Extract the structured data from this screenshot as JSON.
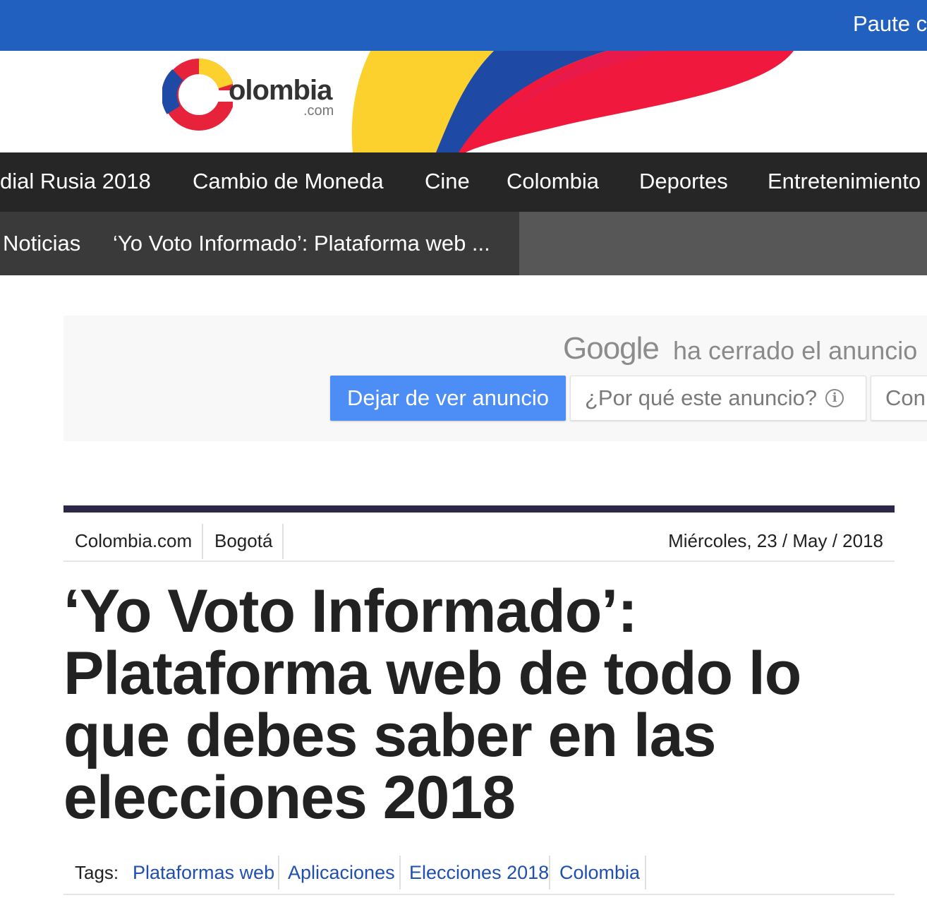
{
  "topbar": {
    "link": "Paute c"
  },
  "header": {
    "logo_text": "olombia",
    "logo_sub": ".com"
  },
  "mainnav": {
    "items": [
      "dial Rusia 2018",
      "Cambio de Moneda",
      "Cine",
      "Colombia",
      "Deportes",
      "Entretenimiento"
    ]
  },
  "breadcrumb": {
    "items": [
      "Noticias",
      "‘Yo Voto Informado’: Plataforma web ..."
    ]
  },
  "ad": {
    "brand": "Google",
    "closed_text": "ha cerrado el anuncio",
    "stop_button": "Dejar de ver anuncio",
    "why_button": "¿Por qué este anuncio?",
    "third_button": "Con"
  },
  "article": {
    "source": "Colombia.com",
    "city": "Bogotá",
    "date": "Miércoles, 23 / May / 2018",
    "headline": "‘Yo Voto Informado’: Plataforma web de todo lo que debes saber en las elecciones 2018",
    "tags_label": "Tags:",
    "tags": [
      "Plataformas web",
      "Aplicaciones",
      "Elecciones 2018",
      "Colombia"
    ]
  },
  "colors": {
    "topbar": "#2160be",
    "nav": "#262626",
    "breadcrumb": "#575757",
    "ad_button": "#4c8df6",
    "rule": "#2c2847",
    "tag_link": "#1f4fb0"
  }
}
